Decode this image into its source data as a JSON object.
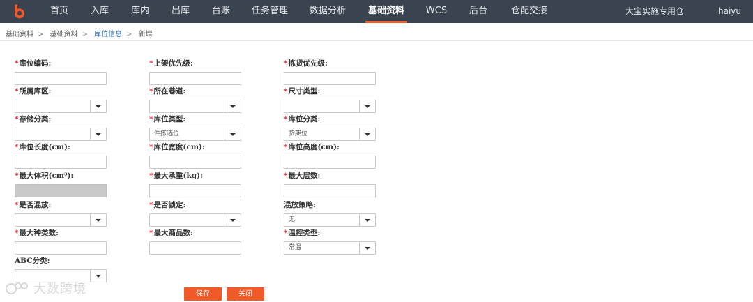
{
  "nav": {
    "items": [
      "首页",
      "入库",
      "库内",
      "出库",
      "台账",
      "任务管理",
      "数据分析",
      "基础资料",
      "WCS",
      "后台",
      "仓配交接"
    ],
    "active": "基础资料",
    "warehouse": "大宝实施专用仓",
    "username": "haiyu"
  },
  "breadcrumb": [
    "基础资料",
    "基础资料",
    "库位信息",
    "新增"
  ],
  "form": {
    "location_code": {
      "label": "库位编码:",
      "value": ""
    },
    "putaway_priority": {
      "label": "上架优先级:",
      "value": ""
    },
    "picking_priority": {
      "label": "拣货优先级:",
      "value": ""
    },
    "zone": {
      "label": "所属库区:",
      "value": ""
    },
    "aisle": {
      "label": "所在巷道:",
      "value": ""
    },
    "size_type": {
      "label": "尺寸类型:",
      "value": ""
    },
    "storage_class": {
      "label": "存储分类:",
      "value": ""
    },
    "location_type": {
      "label": "库位类型:",
      "value": "件拣选位"
    },
    "location_class": {
      "label": "库位分类:",
      "value": "货架位"
    },
    "length": {
      "label": "库位长度(cm):",
      "value": ""
    },
    "width": {
      "label": "库位宽度(cm):",
      "value": ""
    },
    "height": {
      "label": "库位高度(cm):",
      "value": ""
    },
    "max_volume": {
      "label": "最大体积(cm³):",
      "value": ""
    },
    "max_weight": {
      "label": "最大承重(kg):",
      "value": ""
    },
    "max_layers": {
      "label": "最大层数:",
      "value": ""
    },
    "mixed": {
      "label": "是否混放:",
      "value": ""
    },
    "locked": {
      "label": "是否锁定:",
      "value": ""
    },
    "mix_strategy": {
      "label": "混放策略:",
      "value": "无"
    },
    "max_sku_types": {
      "label": "最大种类数:",
      "value": ""
    },
    "max_items": {
      "label": "最大商品数:",
      "value": ""
    },
    "temp_control": {
      "label": "温控类型:",
      "value": "常温"
    },
    "abc_class": {
      "label": "ABC分类:",
      "value": ""
    }
  },
  "buttons": {
    "save": "保存",
    "close": "关闭"
  },
  "watermark": "大数跨境",
  "colors": {
    "topbar": "#3a4450",
    "accent": "#f05a28",
    "required": "#e02020"
  }
}
